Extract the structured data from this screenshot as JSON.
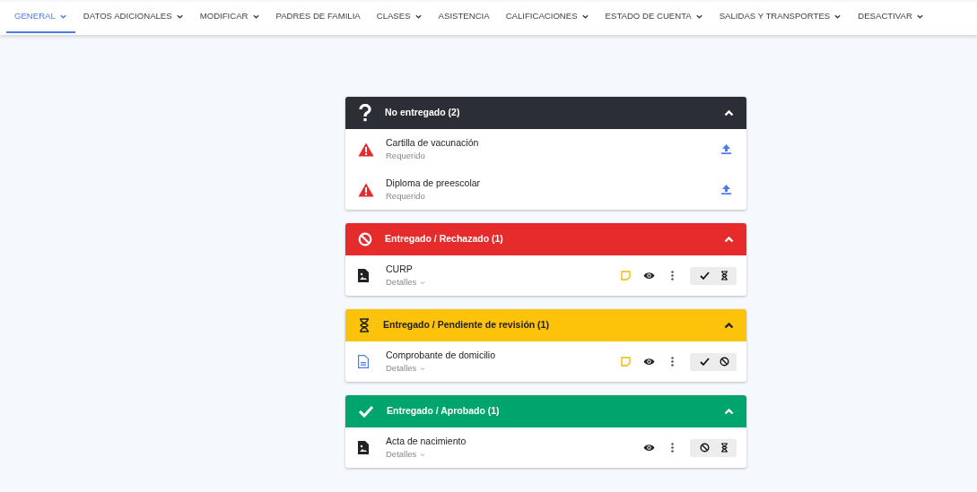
{
  "tabs": [
    {
      "label": "GENERAL",
      "selected": true,
      "dropdown": true
    },
    {
      "label": "DATOS ADICIONALES",
      "selected": false,
      "dropdown": true
    },
    {
      "label": "MODIFICAR",
      "selected": false,
      "dropdown": true
    },
    {
      "label": "PADRES DE FAMILIA",
      "selected": false,
      "dropdown": false
    },
    {
      "label": "CLASES",
      "selected": false,
      "dropdown": true
    },
    {
      "label": "ASISTENCIA",
      "selected": false,
      "dropdown": false
    },
    {
      "label": "CALIFICACIONES",
      "selected": false,
      "dropdown": true
    },
    {
      "label": "ESTADO DE CUENTA",
      "selected": false,
      "dropdown": true
    },
    {
      "label": "SALIDAS Y TRANSPORTES",
      "selected": false,
      "dropdown": true
    },
    {
      "label": "DESACTIVAR",
      "selected": false,
      "dropdown": true
    }
  ],
  "groups": [
    {
      "kind": "missing",
      "title": "No entregado (2)",
      "expanded": true,
      "items": [
        {
          "kind": "required",
          "name": "Cartilla de vacunación",
          "subtitle": "Requerido"
        },
        {
          "kind": "required",
          "name": "Diploma de preescolar",
          "subtitle": "Requerido"
        }
      ]
    },
    {
      "kind": "rejected",
      "title": "Entregado / Rechazado (1)",
      "expanded": true,
      "items": [
        {
          "kind": "delivered",
          "file": {
            "kind": "image"
          },
          "name": "CURP",
          "subtitle": "Detalles",
          "note": true,
          "actions": [
            {
              "kind": "approve"
            },
            {
              "kind": "pending"
            }
          ]
        }
      ]
    },
    {
      "kind": "pending",
      "title": "Entregado / Pendiente de revisión (1)",
      "expanded": true,
      "items": [
        {
          "kind": "delivered",
          "file": {
            "kind": "word"
          },
          "name": "Comprobante de domicilio",
          "subtitle": "Detalles",
          "note": true,
          "actions": [
            {
              "kind": "approve"
            },
            {
              "kind": "reject"
            }
          ]
        }
      ]
    },
    {
      "kind": "approved",
      "title": "Entregado / Aprobado (1)",
      "expanded": true,
      "items": [
        {
          "kind": "delivered",
          "file": {
            "kind": "image"
          },
          "name": "Acta de nacimiento",
          "subtitle": "Detalles",
          "note": false,
          "actions": [
            {
              "kind": "reject"
            },
            {
              "kind": "pending"
            }
          ]
        }
      ]
    }
  ]
}
